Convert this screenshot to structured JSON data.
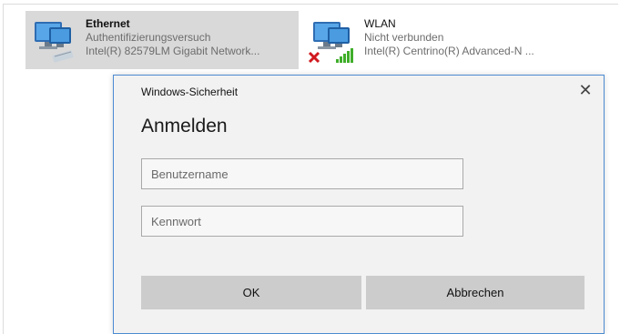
{
  "adapters": {
    "ethernet": {
      "name": "Ethernet",
      "status": "Authentifizierungsversuch",
      "device": "Intel(R) 82579LM Gigabit Network...",
      "icon": "network-computer-icon"
    },
    "wlan": {
      "name": "WLAN",
      "status": "Nicht verbunden",
      "device": "Intel(R) Centrino(R) Advanced-N ...",
      "icon": "wireless-computer-icon"
    }
  },
  "dialog": {
    "title": "Windows-Sicherheit",
    "heading": "Anmelden",
    "close_icon": "close-icon",
    "username_placeholder": "Benutzername",
    "password_placeholder": "Kennwort",
    "ok_label": "OK",
    "cancel_label": "Abbrechen"
  },
  "colors": {
    "dialog_border": "#4c8bd1",
    "selected_adapter_bg": "#d9d9d9",
    "button_bg": "#cccccc",
    "error_x": "#d0191f",
    "signal_green": "#3fae2a"
  }
}
